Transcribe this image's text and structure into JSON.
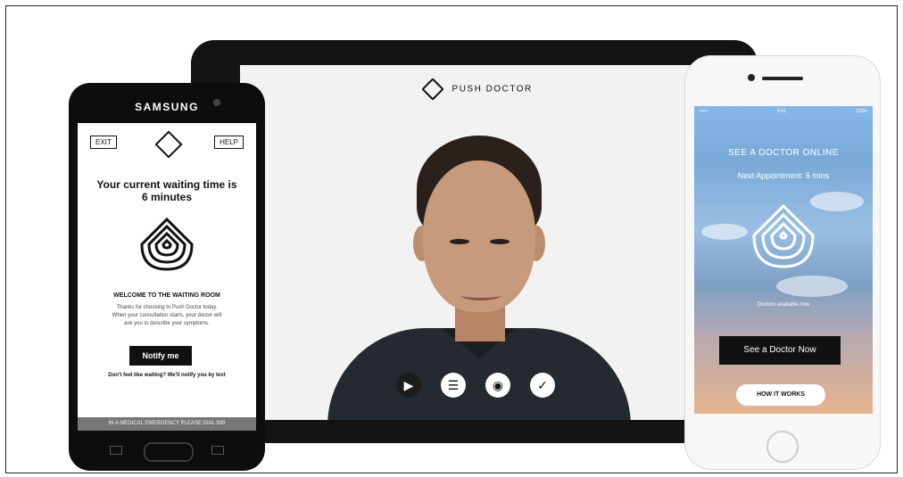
{
  "tablet": {
    "brand": "PUSH DOCTOR",
    "controls": [
      "video-icon",
      "chat-icon",
      "profile-icon",
      "check-icon"
    ]
  },
  "samsung": {
    "brand": "SAMSUNG",
    "exit": "EXIT",
    "help": "HELP",
    "title_line1": "Your current waiting time is",
    "title_line2": "6 minutes",
    "welcome": "WELCOME TO THE WAITING ROOM",
    "body_line1": "Thanks for choosing to Push Doctor today.",
    "body_line2": "When your consultation starts, your doctor will",
    "body_line3": "ask you to describe your symptoms.",
    "notify": "Notify me",
    "wait_text": "Don't feel like waiting? We'll notify you by text",
    "emergency": "IN A MEDICAL EMERGENCY PLEASE DIAL 999"
  },
  "iphone": {
    "status_left": "•••••",
    "status_time": "9:41",
    "status_battery": "100%",
    "title": "SEE A DOCTOR ONLINE",
    "next_appointment": "Next Appointment: 6 mins",
    "available": "Doctors available now",
    "cta": "See a Doctor Now",
    "how": "HOW IT WORKS"
  }
}
